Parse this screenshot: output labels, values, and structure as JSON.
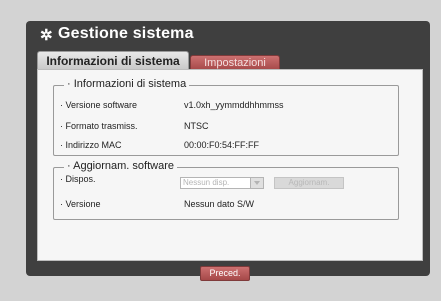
{
  "window": {
    "title": "Gestione sistema",
    "icon": "gear-icon"
  },
  "tabs": [
    {
      "label": "Informazioni di sistema",
      "active": true
    },
    {
      "label": "Impostazioni",
      "active": false
    }
  ],
  "system_info": {
    "legend": "· Informazioni di sistema",
    "rows": [
      {
        "label": "· Versione software",
        "value": "v1.0xh_yymmddhhmmss"
      },
      {
        "label": "· Formato trasmiss.",
        "value": "NTSC"
      },
      {
        "label": "· Indirizzo MAC",
        "value": "00:00:F0:54:FF:FF"
      }
    ]
  },
  "software_update": {
    "legend": "· Aggiornam. software",
    "device_label": "· Dispos.",
    "device_select_value": "Nessun disp.",
    "update_button": "Aggiornam.",
    "version_label": "· Versione",
    "version_value": "Nessun dato S/W"
  },
  "footer": {
    "prev_button": "Preced."
  }
}
